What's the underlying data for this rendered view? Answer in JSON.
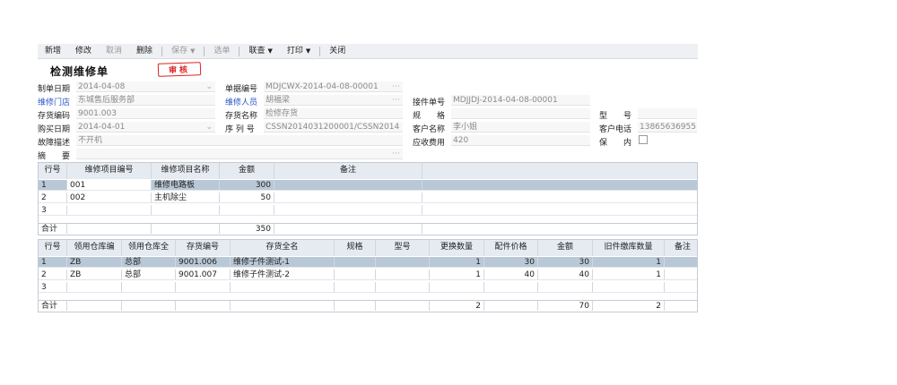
{
  "toolbar": {
    "new": "新增",
    "edit": "修改",
    "cancel": "取消",
    "delete": "删除",
    "save": "保存",
    "select": "选单",
    "link": "联查",
    "print": "打印",
    "close": "关闭"
  },
  "doc": {
    "title": "检测维修单",
    "stamp": "审核"
  },
  "form": {
    "make_date": {
      "label": "制单日期",
      "value": "2014-04-08"
    },
    "bill_no": {
      "label": "单据编号",
      "value": "MDJCWX-2014-04-08-00001"
    },
    "repair_store": {
      "label": "维修门店",
      "value": "东城售后服务部"
    },
    "repairer": {
      "label": "维修人员",
      "value": "胡福梁"
    },
    "receive_no": {
      "label": "接件单号",
      "value": "MDJJDJ-2014-04-08-00001"
    },
    "stock_code": {
      "label": "存货编码",
      "value": "9001.003"
    },
    "stock_name": {
      "label": "存货名称",
      "value": "检修存货"
    },
    "spec": {
      "label": "规　　格",
      "value": ""
    },
    "model": {
      "label": "型　　号",
      "value": ""
    },
    "buy_date": {
      "label": "购买日期",
      "value": "2014-04-01"
    },
    "serial": {
      "label": "序 列 号",
      "value": "CSSN2014031200001/CSSN2014"
    },
    "customer": {
      "label": "客户名称",
      "value": "李小姐"
    },
    "phone": {
      "label": "客户电话",
      "value": "13865636955"
    },
    "fault": {
      "label": "故障描述",
      "value": "不开机"
    },
    "fee": {
      "label": "应收费用",
      "value": "420"
    },
    "warranty": {
      "label": "保　　内"
    },
    "summary": {
      "label": "摘　　要",
      "value": ""
    }
  },
  "grid1": {
    "headers": [
      "行号",
      "维修项目编号",
      "维修项目名称",
      "金额",
      "备注"
    ],
    "rows": [
      {
        "no": "1",
        "code": "001",
        "name": "维修电路板",
        "amount": "300",
        "note": ""
      },
      {
        "no": "2",
        "code": "002",
        "name": "主机除尘",
        "amount": "50",
        "note": ""
      },
      {
        "no": "3",
        "code": "",
        "name": "",
        "amount": "",
        "note": ""
      }
    ],
    "total_label": "合计",
    "total_amount": "350"
  },
  "grid2": {
    "headers": [
      "行号",
      "领用仓库编",
      "领用仓库全",
      "存货编号",
      "存货全名",
      "规格",
      "型号",
      "更换数量",
      "配件价格",
      "金额",
      "旧件缴库数量",
      "备注"
    ],
    "rows": [
      {
        "no": "1",
        "wh_code": "ZB",
        "wh_name": "总部",
        "code": "9001.006",
        "name": "维修子件测试-1",
        "spec": "",
        "model": "",
        "qty": "1",
        "price": "30",
        "amount": "30",
        "old_qty": "1",
        "note": ""
      },
      {
        "no": "2",
        "wh_code": "ZB",
        "wh_name": "总部",
        "code": "9001.007",
        "name": "维修子件测试-2",
        "spec": "",
        "model": "",
        "qty": "1",
        "price": "40",
        "amount": "40",
        "old_qty": "1",
        "note": ""
      },
      {
        "no": "3",
        "wh_code": "",
        "wh_name": "",
        "code": "",
        "name": "",
        "spec": "",
        "model": "",
        "qty": "",
        "price": "",
        "amount": "",
        "old_qty": "",
        "note": ""
      }
    ],
    "total_label": "合计",
    "total_qty": "2",
    "total_amount": "70",
    "total_old_qty": "2"
  }
}
